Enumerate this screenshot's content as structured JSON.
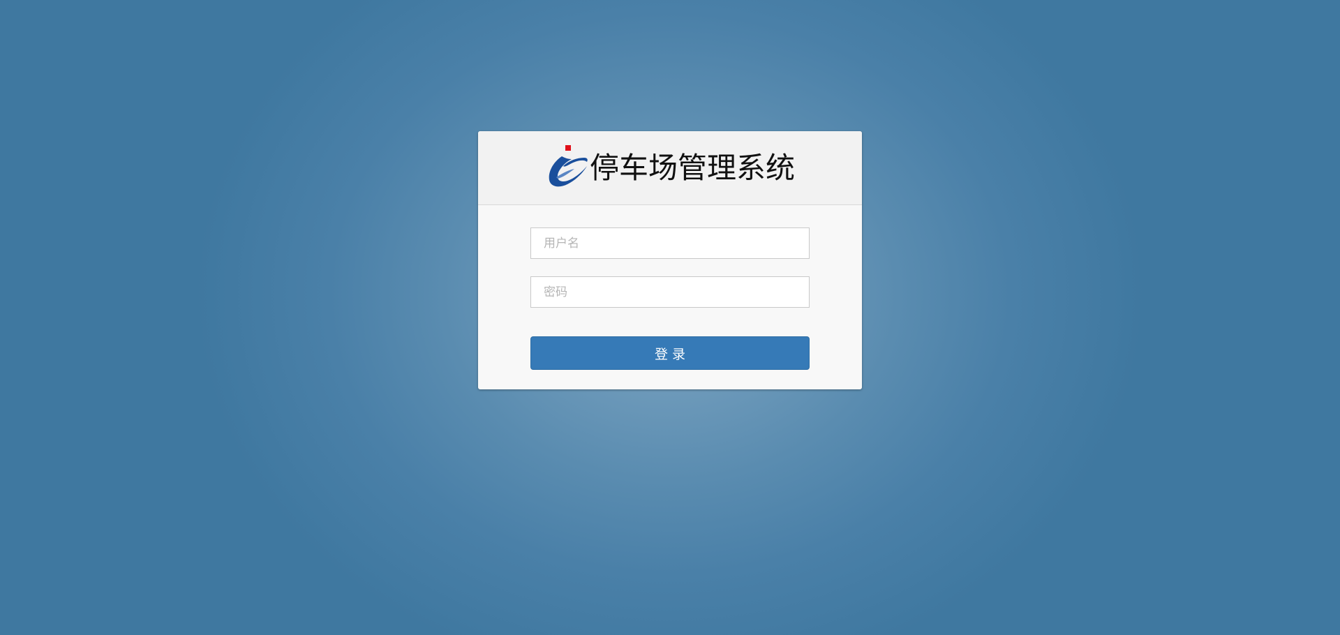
{
  "app": {
    "title": "停车场管理系统",
    "logo_icon": "swoosh-logo-icon",
    "logo_colors": {
      "swoosh": "#1a4f9c",
      "dot": "#e0101a"
    }
  },
  "form": {
    "username_placeholder": "用户名",
    "password_placeholder": "密码",
    "login_label": "登录"
  },
  "colors": {
    "background": "#4a80a8",
    "button": "#367ab7"
  }
}
